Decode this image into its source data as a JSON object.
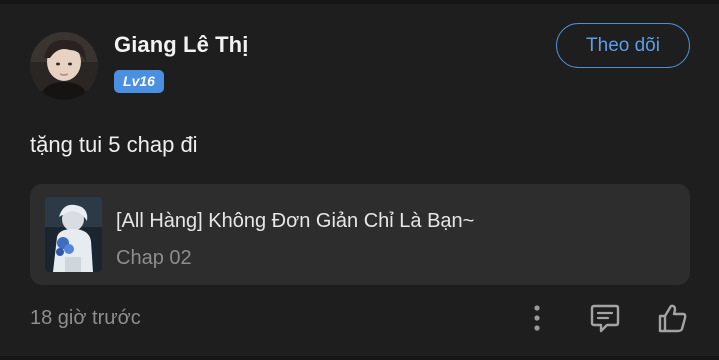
{
  "user": {
    "name": "Giang Lê Thị",
    "level": "Lv16"
  },
  "actions": {
    "follow_label": "Theo dõi"
  },
  "comment": {
    "text": "tặng tui 5 chap đi",
    "timestamp": "18 giờ trước"
  },
  "manga": {
    "title": "[All Hàng] Không Đơn Giản Chỉ Là Bạn~",
    "chapter": "Chap 02"
  },
  "icons": {
    "more": "more-vertical-icon",
    "reply": "comment-icon",
    "like": "thumbs-up-icon"
  },
  "colors": {
    "background": "#1e1e1e",
    "accent": "#4a8fe0",
    "card": "#2d2d2d"
  }
}
